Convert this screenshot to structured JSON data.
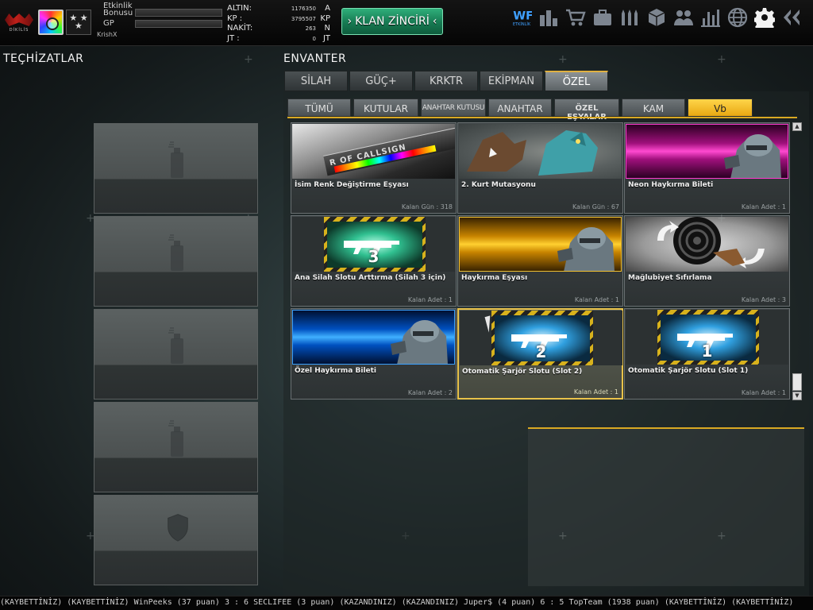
{
  "player": {
    "rank_caption": "DİKİLİS",
    "bonus_label": "Etkinlik Bonusu",
    "gp_label": "GP",
    "username": "KrishX"
  },
  "currency": [
    {
      "label": "ALTIN:",
      "value": "1176350",
      "unit": "A"
    },
    {
      "label": "KP   :",
      "value": "3795507",
      "unit": "KP"
    },
    {
      "label": "NAKİT:",
      "value": "263",
      "unit": "N"
    },
    {
      "label": "JT   :",
      "value": "0",
      "unit": "JT"
    }
  ],
  "clan_button": "KLAN ZİNCİRİ",
  "top_icons": [
    "event-icon",
    "leaderboard-icon",
    "shop-cart-icon",
    "briefcase-icon",
    "ammo-icon",
    "box-icon",
    "clan-icon",
    "stats-icon",
    "globe-icon",
    "settings-icon",
    "back-icon"
  ],
  "event_label": "ETKİNLİK",
  "left_title": "TEÇHİZATLAR",
  "inventory_title": "ENVANTER",
  "main_tabs": [
    "SİLAH",
    "GÜÇ+",
    "KRKTR",
    "EKİPMAN",
    "ÖZEL"
  ],
  "main_tab_active": "ÖZEL",
  "sub_tabs": [
    "TÜMÜ",
    "KUTULAR",
    "ANAHTAR KUTUSU",
    "ANAHTAR",
    "ÖZEL EŞYALAR",
    "KAM",
    "Vb"
  ],
  "sub_tab_active": "Vb",
  "items": [
    {
      "name": "İsim Renk Değiştirme Eşyası",
      "remaining": "Kalan Gün : 318",
      "image": "callsign",
      "image_text": "R OF CALLSIGN"
    },
    {
      "name": "2. Kurt Mutasyonu",
      "remaining": "Kalan Gün : 67",
      "image": "wolf"
    },
    {
      "name": "Neon Haykırma Bileti",
      "remaining": "Kalan Adet : 1",
      "image": "neon"
    },
    {
      "name": "Ana Silah Slotu Arttırma (Silah 3 için)",
      "remaining": "Kalan Adet : 1",
      "image": "slot",
      "slot_number": "3"
    },
    {
      "name": "Haykırma Eşyası",
      "remaining": "Kalan Adet : 1",
      "image": "gold"
    },
    {
      "name": "Mağlubiyet  Sıfırlama",
      "remaining": "Kalan Adet : 3",
      "image": "target"
    },
    {
      "name": "Özel Haykırma Bileti",
      "remaining": "Kalan Adet : 2",
      "image": "blue"
    },
    {
      "name": "Otomatik Şarjör Slotu (Slot 2)",
      "remaining": "Kalan Adet : 1",
      "image": "slot-blue",
      "slot_number": "2",
      "selected": true
    },
    {
      "name": "Otomatik Şarjör Slotu (Slot 1)",
      "remaining": "Kalan Adet : 1",
      "image": "slot-blue",
      "slot_number": "1"
    }
  ],
  "ticker": "(KAYBETTİNİZ)    (KAYBETTİNİZ) WinPeeks (37 puan) 3 : 6 SECLIFEE (3 puan) (KAZANDINIZ)     (KAZANDINIZ) Juper$ (4 puan) 6 : 5 TopTeam (1938 puan) (KAYBETTİNİZ)     (KAYBETTİNİZ)",
  "colors": {
    "accent_gold": "#e9c24a",
    "clan_green": "#167a52"
  }
}
